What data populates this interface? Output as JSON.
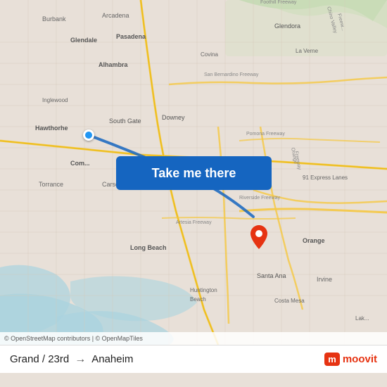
{
  "map": {
    "attribution": "© OpenStreetMap contributors | © OpenMapTiles"
  },
  "button": {
    "label": "Take me there"
  },
  "footer": {
    "origin": "Grand / 23rd",
    "destination": "Anaheim",
    "arrow": "→",
    "logo_text": "moovit"
  }
}
